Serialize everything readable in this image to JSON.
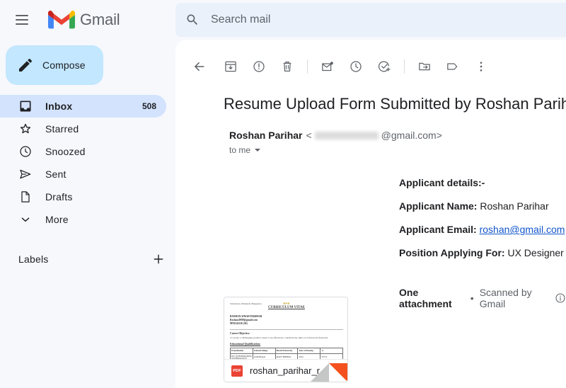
{
  "app": {
    "brand": "Gmail",
    "menu_icon": "hamburger-icon",
    "logo_icon": "gmail-logo-icon"
  },
  "search": {
    "placeholder": "Search mail",
    "value": "",
    "icon": "search-icon"
  },
  "sidebar": {
    "compose": {
      "label": "Compose",
      "icon": "pencil-icon"
    },
    "items": [
      {
        "label": "Inbox",
        "icon": "inbox-icon",
        "count": "508",
        "active": true
      },
      {
        "label": "Starred",
        "icon": "star-icon",
        "count": "",
        "active": false
      },
      {
        "label": "Snoozed",
        "icon": "clock-icon",
        "count": "",
        "active": false
      },
      {
        "label": "Sent",
        "icon": "send-icon",
        "count": "",
        "active": false
      },
      {
        "label": "Drafts",
        "icon": "draft-icon",
        "count": "",
        "active": false
      },
      {
        "label": "More",
        "icon": "chevron-down-icon",
        "count": "",
        "active": false
      }
    ],
    "labels": {
      "title": "Labels",
      "add_icon": "plus-icon"
    }
  },
  "toolbar": {
    "buttons": [
      {
        "name": "back-button",
        "icon": "arrow-left-icon"
      },
      {
        "name": "archive-button",
        "icon": "archive-icon"
      },
      {
        "name": "report-spam-button",
        "icon": "report-spam-icon"
      },
      {
        "name": "delete-button",
        "icon": "trash-icon"
      },
      {
        "name": "mark-unread-button",
        "icon": "mark-unread-icon"
      },
      {
        "name": "snooze-button",
        "icon": "clock-icon"
      },
      {
        "name": "add-to-tasks-button",
        "icon": "add-task-icon"
      },
      {
        "name": "move-to-button",
        "icon": "move-to-folder-icon"
      },
      {
        "name": "labels-button",
        "icon": "label-icon"
      },
      {
        "name": "more-options-button",
        "icon": "more-vertical-icon"
      }
    ]
  },
  "email": {
    "subject": "Resume Upload Form Submitted by Roshan Parihar",
    "sender_name": "Roshan Parihar",
    "sender_email_domain": "@gmail.com",
    "sender_email_open": "<",
    "sender_email_close": ">",
    "recipient": "to me",
    "body": {
      "heading": "Applicant details:-",
      "name_label": "Applicant Name:",
      "name_value": "Roshan Parihar",
      "email_label": "Applicant Email:",
      "email_value": "roshan@gmail.com",
      "position_label": "Position Applying For:",
      "position_value": "UX Designer"
    },
    "attachments": {
      "count_text": "One attachment",
      "separator": "•",
      "scan_text": "Scanned by Gmail",
      "info_icon": "info-icon",
      "file": {
        "name": "roshan_parihar_r...",
        "type_badge": "PDF"
      }
    }
  },
  "attachment_preview": {
    "mark": "RPR",
    "title": "CURRICULUM VITAE",
    "address": "Vrindavan, Mahendi, Bangalore",
    "contact_lines": [
      "ROSHAN SINGH PARIHAR",
      "Roshan.0000@gmail.com",
      "9876543210 (M)"
    ],
    "objective_heading": "Career Objective",
    "objective_text": "To secure a challenging position where I can effectively contribute my skills as Software Professional.",
    "education_heading": "Educational Qualification:",
    "table": {
      "headers": [
        "Examination",
        "School/College",
        "Board/University",
        "Year of Passing",
        "%"
      ],
      "rows": [
        [
          "B.E. (INFORMATION TECHNOLOGY)",
          "GSM Bhopal",
          "RGPV BHOPAL",
          "2014",
          "70.5%"
        ]
      ]
    }
  },
  "colors": {
    "accent_blue": "#c2e7ff",
    "active_blue": "#d3e3fd",
    "search_bg": "#eaf1fb",
    "page_bg": "#f6f8fc",
    "link": "#1155cc",
    "pdf_red": "#ea4335",
    "fold_orange": "#f4511e"
  }
}
